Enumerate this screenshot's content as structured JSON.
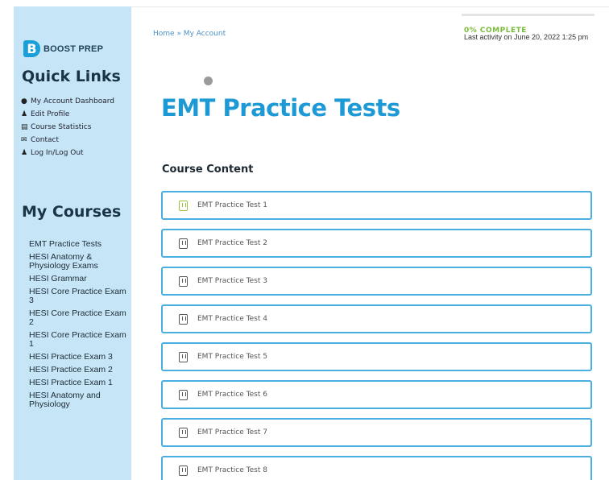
{
  "brand": {
    "logo_letter": "B",
    "name": "BOOST PREP"
  },
  "sidebar": {
    "quick_links_heading": "Quick Links",
    "quick_links": [
      {
        "label": "My Account Dashboard",
        "icon": "user-circle-icon"
      },
      {
        "label": "Edit Profile",
        "icon": "user-edit-icon"
      },
      {
        "label": "Course Statistics",
        "icon": "document-icon"
      },
      {
        "label": "Contact",
        "icon": "envelope-icon"
      },
      {
        "label": "Log In/Log Out",
        "icon": "users-icon"
      }
    ],
    "my_courses_heading": "My Courses",
    "courses": [
      "EMT Practice Tests",
      "HESI Anatomy & Physiology Exams",
      "HESI Grammar",
      "HESI Core Practice Exam 3",
      "HESI Core Practice Exam 2",
      "HESI Core Practice Exam 1",
      "HESI Practice Exam 3",
      "HESI Practice Exam 2",
      "HESI Practice Exam 1",
      "HESI Anatomy and Physiology"
    ]
  },
  "header": {
    "breadcrumb": "Home » My Account",
    "progress_percent": 0,
    "progress_label": "0% COMPLETE",
    "last_activity": "Last activity on June 20, 2022 1:25 pm"
  },
  "main": {
    "title": "EMT Practice Tests",
    "section_title": "Course Content",
    "lessons": [
      {
        "label": "EMT Practice Test 1",
        "status": "current"
      },
      {
        "label": "EMT Practice Test 2",
        "status": "not-started"
      },
      {
        "label": "EMT Practice Test 3",
        "status": "not-started"
      },
      {
        "label": "EMT Practice Test 4",
        "status": "not-started"
      },
      {
        "label": "EMT Practice Test 5",
        "status": "not-started"
      },
      {
        "label": "EMT Practice Test 6",
        "status": "not-started"
      },
      {
        "label": "EMT Practice Test 7",
        "status": "not-started"
      },
      {
        "label": "EMT Practice Test 8",
        "status": "not-started"
      }
    ]
  },
  "colors": {
    "accent": "#1d9ad6",
    "sidebar_bg": "#c6e6f7",
    "complete": "#7ab93b",
    "card_border": "#4aaee0"
  }
}
